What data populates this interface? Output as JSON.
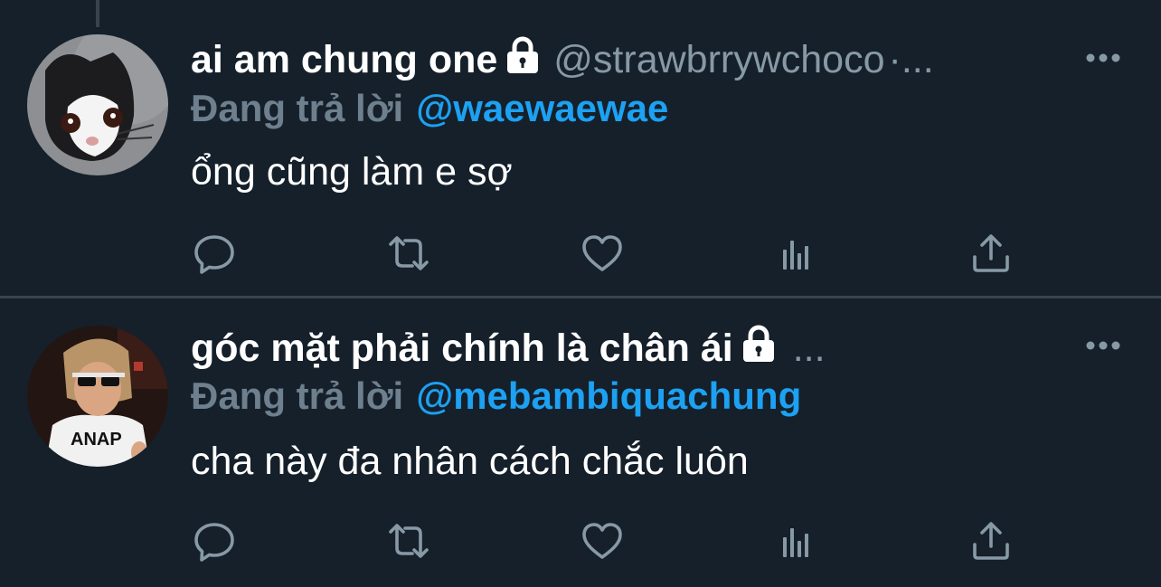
{
  "tweets": [
    {
      "display_name": "ai am chung one",
      "handle": "@strawbrrywchoco",
      "handle_suffix": "·...",
      "reply_prefix": "Đang trả lời",
      "reply_mention": "@waewaewae",
      "text": "ổng cũng làm e sợ",
      "locked": true
    },
    {
      "display_name": "góc mặt phải chính là chân ái",
      "handle": "",
      "handle_suffix": "...",
      "reply_prefix": "Đang trả lời",
      "reply_mention": "@mebambiquachung",
      "text": "cha này đa nhân cách chắc luôn",
      "locked": true
    }
  ],
  "action_icons": [
    "reply-icon",
    "retweet-icon",
    "like-icon",
    "analytics-icon",
    "share-icon"
  ],
  "colors": {
    "background": "#15202b",
    "divider": "#38444d",
    "secondary_text": "#8899a6",
    "accent": "#1da1f2"
  }
}
